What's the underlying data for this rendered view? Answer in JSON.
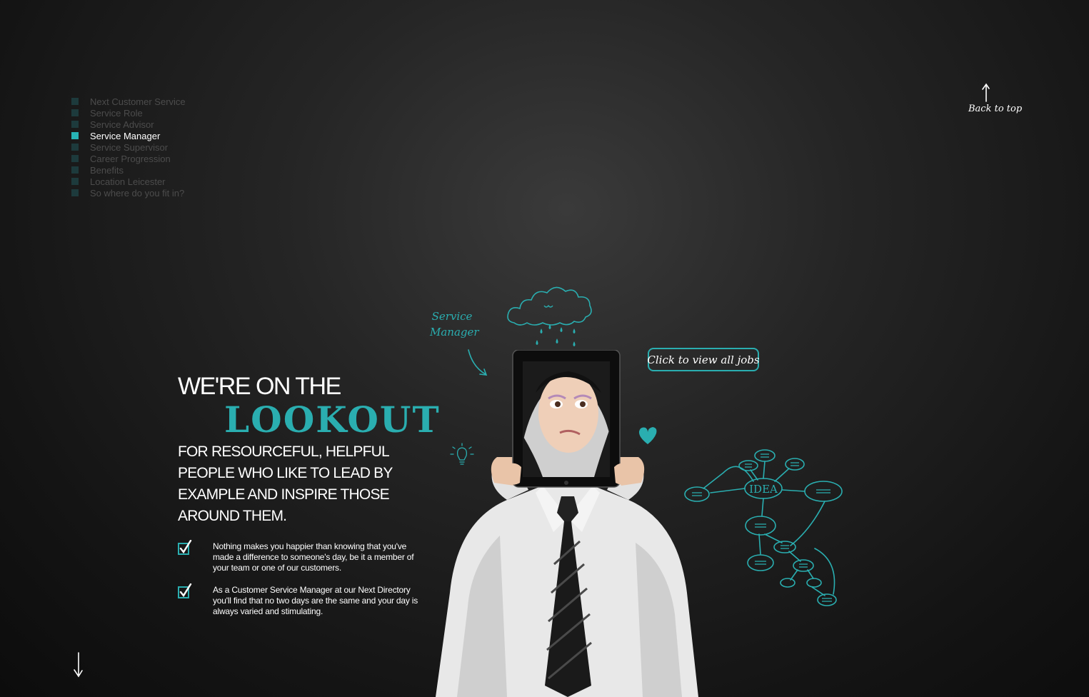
{
  "nav": {
    "items": [
      {
        "label": "Next Customer Service"
      },
      {
        "label": "Service Role"
      },
      {
        "label": "Service Advisor"
      },
      {
        "label": "Service Manager",
        "active": true
      },
      {
        "label": "Service Supervisor"
      },
      {
        "label": "Career Progression"
      },
      {
        "label": "Benefits"
      },
      {
        "label": "Location Leicester"
      },
      {
        "label": "So where do you fit in?"
      }
    ]
  },
  "back_to_top": {
    "label": "Back to top"
  },
  "hero": {
    "headline_line1": "WE'RE ON THE",
    "headline_line2": "LOOKOUT",
    "subheadline": "FOR RESOURCEFUL, HELPFUL PEOPLE WHO LIKE TO LEAD BY EXAMPLE AND INSPIRE THOSE AROUND THEM."
  },
  "points": [
    {
      "text": "Nothing makes you happier than knowing that you've made a difference to someone's day, be it a member of your team or one of our customers."
    },
    {
      "text": "As a Customer Service Manager at our Next Directory you'll find that no two days are the same and your day is always varied and stimulating."
    }
  ],
  "doodles": {
    "role_tag": "Service Manager",
    "idea_label": "IDEA"
  },
  "jobs_button": {
    "label": "Click to view all jobs"
  },
  "colors": {
    "accent": "#2aaeb0",
    "nav_inactive": "#4c4c4c",
    "nav_square": "#1d3a3c"
  }
}
